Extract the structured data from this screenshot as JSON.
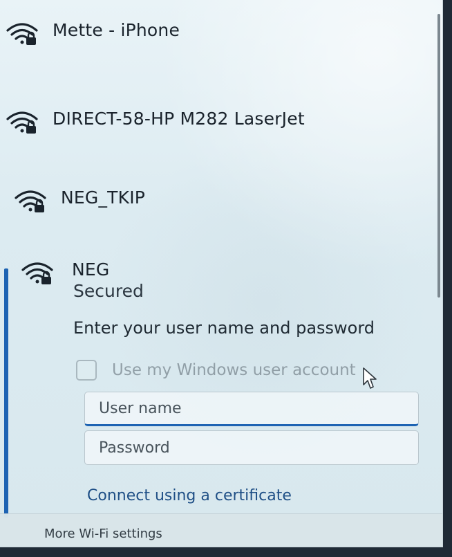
{
  "networks": [
    {
      "name": "Mette - iPhone",
      "icon": "wifi-secured-icon"
    },
    {
      "name": "DIRECT-58-HP M282 LaserJet",
      "icon": "wifi-secured-icon"
    },
    {
      "name": "NEG_TKIP",
      "icon": "wifi-secured-icon"
    },
    {
      "name": "NEG",
      "icon": "wifi-secured-icon",
      "status": "Secured"
    }
  ],
  "login": {
    "prompt": "Enter your user name and password",
    "use_windows_account_label": "Use my Windows user account",
    "username_placeholder": "User name",
    "password_placeholder": "Password",
    "certificate_link": "Connect using a certificate"
  },
  "footer": {
    "more_settings": "More Wi-Fi settings"
  },
  "colors": {
    "accent": "#1d63b3",
    "panel": "#dcebf1"
  }
}
